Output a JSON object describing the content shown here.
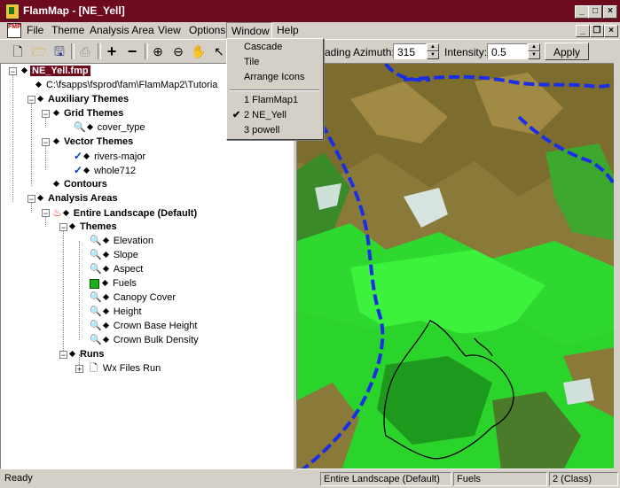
{
  "window": {
    "title": "FlamMap - [NE_Yell]",
    "controls": [
      "minimize",
      "maximize",
      "close"
    ]
  },
  "menubar": {
    "items": [
      "File",
      "Theme",
      "Analysis Area",
      "View",
      "Options",
      "Window",
      "Help"
    ],
    "active": "Window",
    "mdi_controls": [
      "minimize",
      "restore",
      "close"
    ]
  },
  "toolbar": {
    "buttons": [
      "new-file",
      "open-folder",
      "save",
      "print",
      "add",
      "remove",
      "zoom-in",
      "zoom-out",
      "pan-hand",
      "pointer"
    ],
    "shading_azimuth_label": "ading Azimuth:",
    "shading_azimuth_value": "315",
    "intensity_label": "Intensity:",
    "intensity_value": "0.5",
    "apply_label": "Apply"
  },
  "window_menu": {
    "items": [
      "Cascade",
      "Tile",
      "Arrange Icons"
    ],
    "windows": [
      "1 FlamMap1",
      "2 NE_Yell",
      "3 powell"
    ],
    "checked": "2 NE_Yell"
  },
  "tree": {
    "root": "NE_Yell.fmp",
    "path": "C:\\fsapps\\fsprod\\fam\\FlamMap2\\Tutoria",
    "auxiliary_themes": "Auxiliary Themes",
    "grid_themes": "Grid Themes",
    "cover_type": "cover_type",
    "vector_themes": "Vector Themes",
    "rivers_major": "rivers-major",
    "whole712": "whole712",
    "contours": "Contours",
    "analysis_areas": "Analysis Areas",
    "entire_landscape": "Entire Landscape (Default)",
    "themes": "Themes",
    "theme_items": [
      "Elevation",
      "Slope",
      "Aspect",
      "Fuels",
      "Canopy Cover",
      "Height",
      "Crown Base Height",
      "Crown Bulk Density"
    ],
    "runs": "Runs",
    "wx_files_run": "Wx Files Run"
  },
  "status": {
    "ready": "Ready",
    "analysis_area": "Entire Landscape (Default)",
    "theme": "Fuels",
    "classes": "2 (Class)"
  },
  "colors": {
    "title_bar": "#6e0a1e",
    "map_bright_green": "#2ff02f",
    "map_olive": "#8a7a3a",
    "river_blue": "#1a2ee6"
  }
}
